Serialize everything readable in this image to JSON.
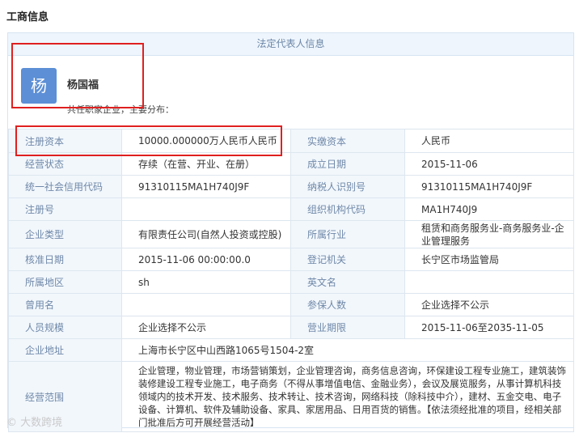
{
  "section_title": "工商信息",
  "panel_title": "法定代表人信息",
  "representative": {
    "avatar_char": "杨",
    "name": "杨国福",
    "sub": "共任职家企业，主要分布："
  },
  "rows": [
    {
      "l1": "注册资本",
      "v1": "10000.000000万人民币人民币",
      "l2": "实缴资本",
      "v2": "人民币"
    },
    {
      "l1": "经营状态",
      "v1": "存续（在营、开业、在册）",
      "l2": "成立日期",
      "v2": "2015-11-06"
    },
    {
      "l1": "统一社会信用代码",
      "v1": "91310115MA1H740J9F",
      "l2": "纳税人识别号",
      "v2": "91310115MA1H740J9F"
    },
    {
      "l1": "注册号",
      "v1": "",
      "l2": "组织机构代码",
      "v2": "MA1H740J9"
    },
    {
      "l1": "企业类型",
      "v1": "有限责任公司(自然人投资或控股)",
      "l2": "所属行业",
      "v2": "租赁和商务服务业-商务服务业-企业管理服务"
    },
    {
      "l1": "核准日期",
      "v1": "2015-11-06 00:00:00.0",
      "l2": "登记机关",
      "v2": "长宁区市场监管局"
    },
    {
      "l1": "所属地区",
      "v1": "sh",
      "l2": "英文名",
      "v2": ""
    },
    {
      "l1": "曾用名",
      "v1": "",
      "l2": "参保人数",
      "v2": "企业选择不公示"
    },
    {
      "l1": "人员规模",
      "v1": "企业选择不公示",
      "l2": "营业期限",
      "v2": "2015-11-06至2035-11-05"
    }
  ],
  "address": {
    "label": "企业地址",
    "value": "上海市长宁区中山西路1065号1504-2室"
  },
  "scope": {
    "label": "经营范围",
    "value": "企业管理，物业管理，市场营销策划，企业管理咨询，商务信息咨询，环保建设工程专业施工，建筑装饰装修建设工程专业施工，电子商务（不得从事增值电信、金融业务），会议及展览服务，从事计算机科技领域内的技术开发、技术服务、技术转让、技术咨询，网络科技（除科技中介），建材、五金交电、电子设备、计算机、软件及辅助设备、家具、家居用品、日用百货的销售。【依法须经批准的项目，经相关部门批准后方可开展经营活动】"
  },
  "watermark": "大数跨境"
}
